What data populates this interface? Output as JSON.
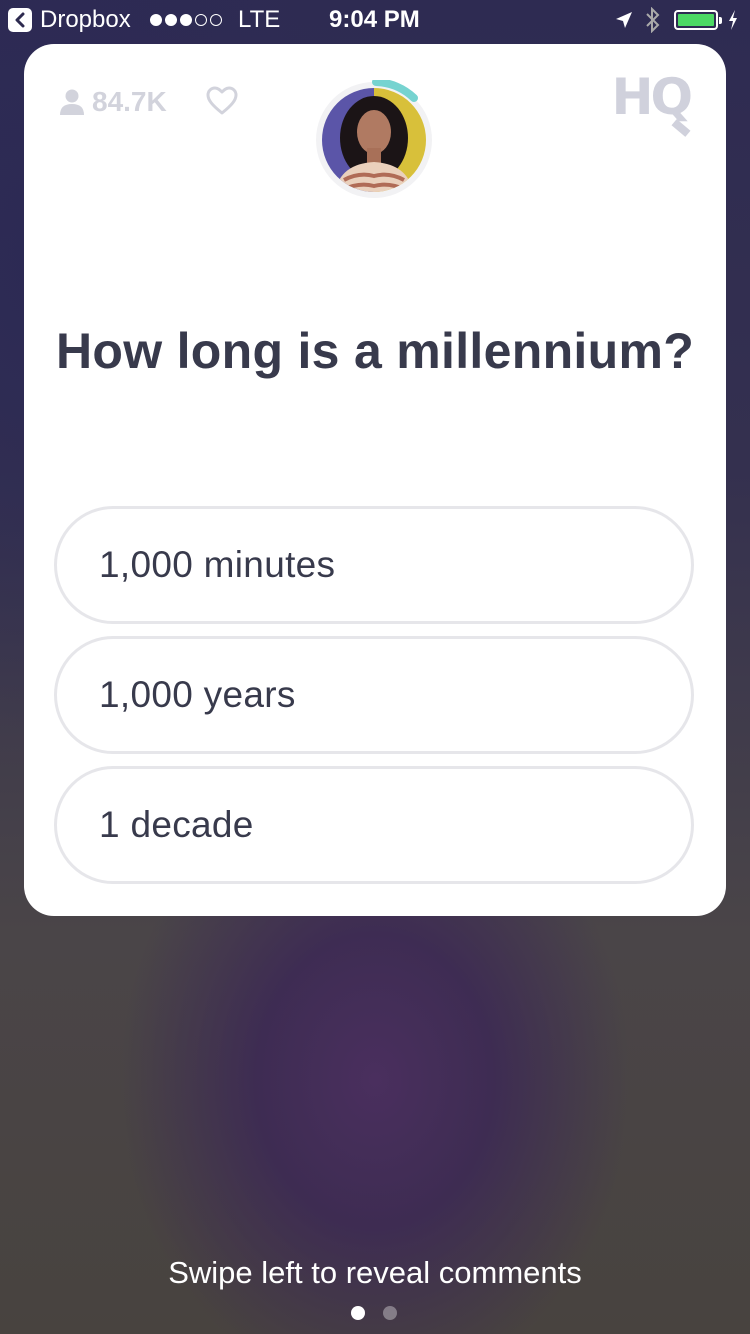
{
  "status_bar": {
    "back_app": "Dropbox",
    "signal_bars": 3,
    "signal_total": 5,
    "carrier": "LTE",
    "time": "9:04 PM",
    "battery_level": 1.0,
    "colors": {
      "battery": "#4cd964"
    }
  },
  "card": {
    "viewer_count": "84.7K",
    "viewer_icon": "user-icon",
    "heart_icon": "heart-icon",
    "logo": "HQ",
    "timer_color": "#76d3d0",
    "question": "How long is a millennium?",
    "answers": [
      {
        "label": "1,000 minutes"
      },
      {
        "label": "1,000 years"
      },
      {
        "label": "1 decade"
      }
    ]
  },
  "footer": {
    "hint": "Swipe left to reveal comments",
    "pages": 2,
    "active_page": 1
  }
}
